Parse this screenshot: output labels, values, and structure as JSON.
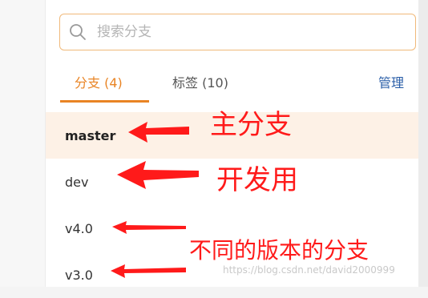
{
  "search": {
    "placeholder": "搜索分支",
    "value": ""
  },
  "tabs": [
    {
      "label": "分支 (4)",
      "active": true
    },
    {
      "label": "标签 (10)",
      "active": false
    }
  ],
  "manage_label": "管理",
  "branches": [
    {
      "name": "master",
      "current": true
    },
    {
      "name": "dev",
      "current": false
    },
    {
      "name": "v4.0",
      "current": false
    },
    {
      "name": "v3.0",
      "current": false
    }
  ],
  "annotations": {
    "main_branch": "主分支",
    "dev_branch": "开发用",
    "versions": "不同的版本的分支"
  },
  "watermark": "https://blog.csdn.net/david2000999",
  "colors": {
    "accent": "#e98424",
    "link": "#2b5fa8",
    "annotation": "#ff1a1a",
    "current_row_bg": "#fdf1e6",
    "search_border": "#f0b97a"
  },
  "icons": {
    "search": "search-icon"
  }
}
